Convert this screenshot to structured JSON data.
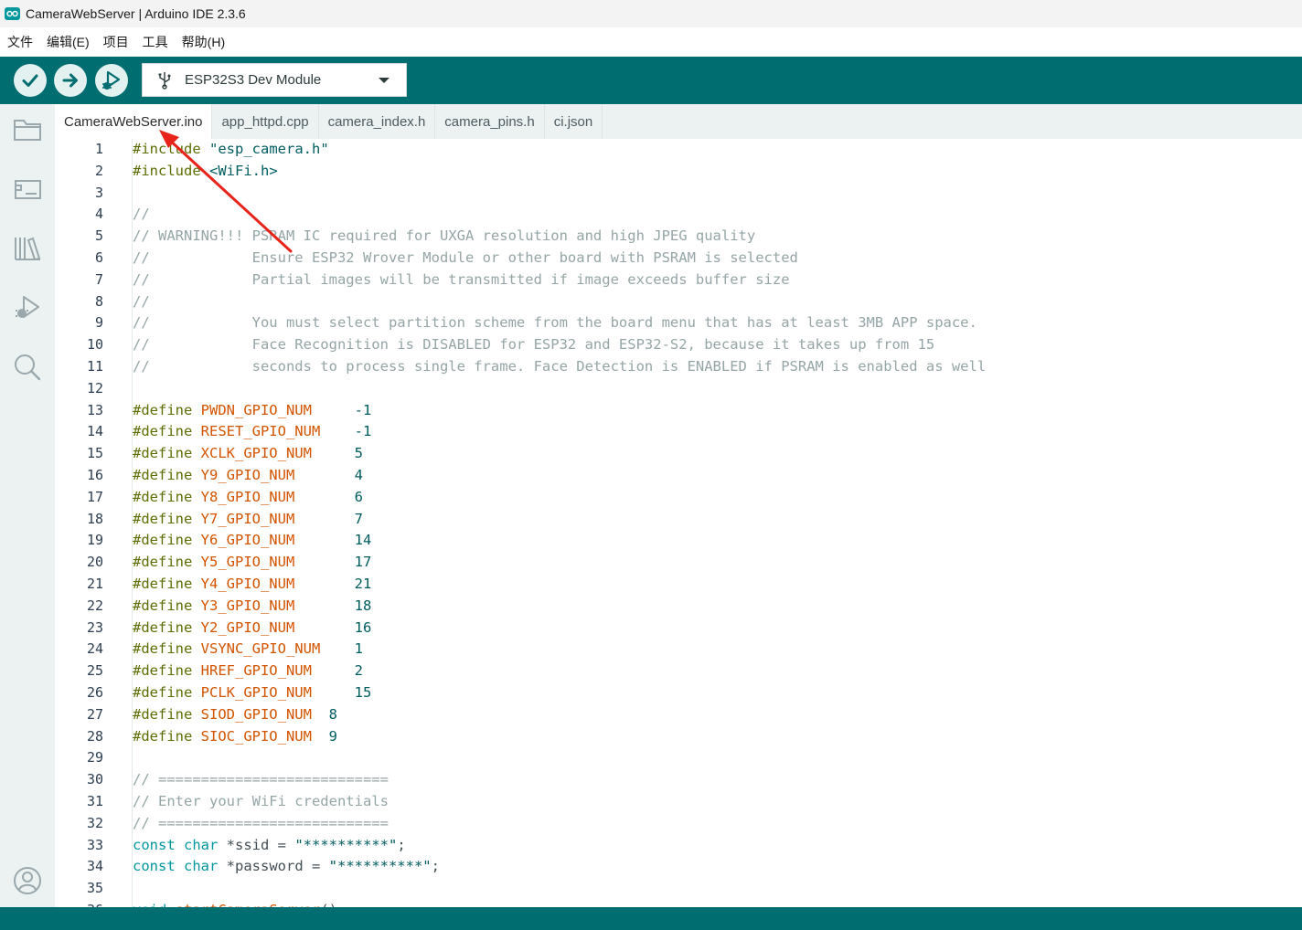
{
  "window": {
    "title": "CameraWebServer | Arduino IDE 2.3.6"
  },
  "menu": {
    "items": [
      "文件",
      "编辑(E)",
      "项目",
      "工具",
      "帮助(H)"
    ]
  },
  "toolbar": {
    "verify_icon": "check-icon",
    "upload_icon": "arrow-right-icon",
    "debug_icon": "debug-icon",
    "board_name": "ESP32S3 Dev Module",
    "board_icon": "usb-icon"
  },
  "sidebar": {
    "items": [
      "folder-icon",
      "board-icon",
      "library-icon",
      "debug-icon",
      "search-icon",
      "account-icon"
    ]
  },
  "tabs": [
    {
      "label": "CameraWebServer.ino",
      "active": true
    },
    {
      "label": "app_httpd.cpp",
      "active": false
    },
    {
      "label": "camera_index.h",
      "active": false
    },
    {
      "label": "camera_pins.h",
      "active": false
    },
    {
      "label": "ci.json",
      "active": false
    }
  ],
  "editor": {
    "lines": [
      [
        [
          "c-pre",
          "#include "
        ],
        [
          "c-str",
          "\"esp_camera.h\""
        ]
      ],
      [
        [
          "c-pre",
          "#include "
        ],
        [
          "c-str",
          "<WiFi.h>"
        ]
      ],
      [],
      [
        [
          "c-comment",
          "//"
        ]
      ],
      [
        [
          "c-comment",
          "// WARNING!!! PSRAM IC required for UXGA resolution and high JPEG quality"
        ]
      ],
      [
        [
          "c-comment",
          "//            Ensure ESP32 Wrover Module or other board with PSRAM is selected"
        ]
      ],
      [
        [
          "c-comment",
          "//            Partial images will be transmitted if image exceeds buffer size"
        ]
      ],
      [
        [
          "c-comment",
          "//"
        ]
      ],
      [
        [
          "c-comment",
          "//            You must select partition scheme from the board menu that has at least 3MB APP space."
        ]
      ],
      [
        [
          "c-comment",
          "//            Face Recognition is DISABLED for ESP32 and ESP32-S2, because it takes up from 15"
        ]
      ],
      [
        [
          "c-comment",
          "//            seconds to process single frame. Face Detection is ENABLED if PSRAM is enabled as well"
        ]
      ],
      [],
      [
        [
          "c-pre",
          "#define "
        ],
        [
          "c-macro",
          "PWDN_GPIO_NUM"
        ],
        [
          "c-plain",
          "     "
        ],
        [
          "c-num",
          "-1"
        ]
      ],
      [
        [
          "c-pre",
          "#define "
        ],
        [
          "c-macro",
          "RESET_GPIO_NUM"
        ],
        [
          "c-plain",
          "    "
        ],
        [
          "c-num",
          "-1"
        ]
      ],
      [
        [
          "c-pre",
          "#define "
        ],
        [
          "c-macro",
          "XCLK_GPIO_NUM"
        ],
        [
          "c-plain",
          "     "
        ],
        [
          "c-num",
          "5"
        ]
      ],
      [
        [
          "c-pre",
          "#define "
        ],
        [
          "c-macro",
          "Y9_GPIO_NUM"
        ],
        [
          "c-plain",
          "       "
        ],
        [
          "c-num",
          "4"
        ]
      ],
      [
        [
          "c-pre",
          "#define "
        ],
        [
          "c-macro",
          "Y8_GPIO_NUM"
        ],
        [
          "c-plain",
          "       "
        ],
        [
          "c-num",
          "6"
        ]
      ],
      [
        [
          "c-pre",
          "#define "
        ],
        [
          "c-macro",
          "Y7_GPIO_NUM"
        ],
        [
          "c-plain",
          "       "
        ],
        [
          "c-num",
          "7"
        ]
      ],
      [
        [
          "c-pre",
          "#define "
        ],
        [
          "c-macro",
          "Y6_GPIO_NUM"
        ],
        [
          "c-plain",
          "       "
        ],
        [
          "c-num",
          "14"
        ]
      ],
      [
        [
          "c-pre",
          "#define "
        ],
        [
          "c-macro",
          "Y5_GPIO_NUM"
        ],
        [
          "c-plain",
          "       "
        ],
        [
          "c-num",
          "17"
        ]
      ],
      [
        [
          "c-pre",
          "#define "
        ],
        [
          "c-macro",
          "Y4_GPIO_NUM"
        ],
        [
          "c-plain",
          "       "
        ],
        [
          "c-num",
          "21"
        ]
      ],
      [
        [
          "c-pre",
          "#define "
        ],
        [
          "c-macro",
          "Y3_GPIO_NUM"
        ],
        [
          "c-plain",
          "       "
        ],
        [
          "c-num",
          "18"
        ]
      ],
      [
        [
          "c-pre",
          "#define "
        ],
        [
          "c-macro",
          "Y2_GPIO_NUM"
        ],
        [
          "c-plain",
          "       "
        ],
        [
          "c-num",
          "16"
        ]
      ],
      [
        [
          "c-pre",
          "#define "
        ],
        [
          "c-macro",
          "VSYNC_GPIO_NUM"
        ],
        [
          "c-plain",
          "    "
        ],
        [
          "c-num",
          "1"
        ]
      ],
      [
        [
          "c-pre",
          "#define "
        ],
        [
          "c-macro",
          "HREF_GPIO_NUM"
        ],
        [
          "c-plain",
          "     "
        ],
        [
          "c-num",
          "2"
        ]
      ],
      [
        [
          "c-pre",
          "#define "
        ],
        [
          "c-macro",
          "PCLK_GPIO_NUM"
        ],
        [
          "c-plain",
          "     "
        ],
        [
          "c-num",
          "15"
        ]
      ],
      [
        [
          "c-pre",
          "#define "
        ],
        [
          "c-macro",
          "SIOD_GPIO_NUM"
        ],
        [
          "c-plain",
          "  "
        ],
        [
          "c-num",
          "8"
        ]
      ],
      [
        [
          "c-pre",
          "#define "
        ],
        [
          "c-macro",
          "SIOC_GPIO_NUM"
        ],
        [
          "c-plain",
          "  "
        ],
        [
          "c-num",
          "9"
        ]
      ],
      [],
      [
        [
          "c-comment",
          "// ==========================="
        ]
      ],
      [
        [
          "c-comment",
          "// Enter your WiFi credentials"
        ]
      ],
      [
        [
          "c-comment",
          "// ==========================="
        ]
      ],
      [
        [
          "c-kw",
          "const "
        ],
        [
          "c-kw",
          "char "
        ],
        [
          "c-plain",
          "*ssid = "
        ],
        [
          "c-str",
          "\"**********\""
        ],
        [
          "c-plain",
          ";"
        ]
      ],
      [
        [
          "c-kw",
          "const "
        ],
        [
          "c-kw",
          "char "
        ],
        [
          "c-plain",
          "*password = "
        ],
        [
          "c-str",
          "\"**********\""
        ],
        [
          "c-plain",
          ";"
        ]
      ],
      [],
      [
        [
          "c-kw",
          "void "
        ],
        [
          "c-macro",
          "startCameraServer"
        ],
        [
          "c-plain",
          "();"
        ]
      ]
    ]
  },
  "colors": {
    "toolbar": "#006d70",
    "sidebar": "#ecf1f1",
    "annotation_arrow": "#e8231a"
  }
}
